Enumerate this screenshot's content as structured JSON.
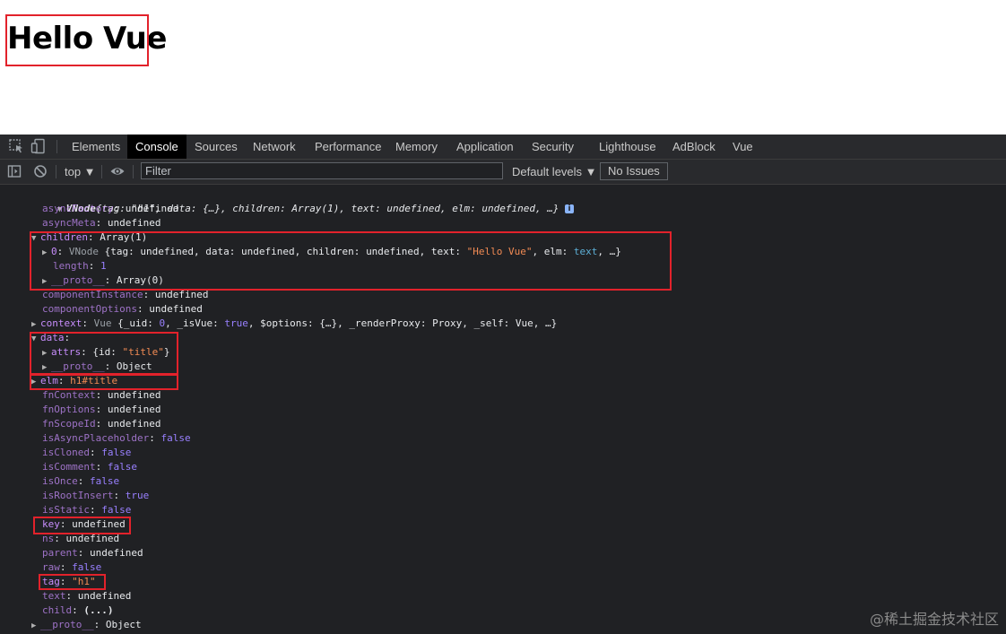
{
  "page": {
    "heading": "Hello Vue"
  },
  "devtools": {
    "tabs": [
      "Elements",
      "Console",
      "Sources",
      "Network",
      "Performance",
      "Memory",
      "Application",
      "Security",
      "Lighthouse",
      "AdBlock",
      "Vue"
    ],
    "active_tab": "Console",
    "toolbar": {
      "context": "top ▼",
      "filter_placeholder": "Filter",
      "levels": "Default levels ▼",
      "issues": "No Issues"
    }
  },
  "console": {
    "header": {
      "name": "VNode",
      "preview": "{tag: \"h1\", data: {…}, children: Array(1), text: undefined, elm: undefined, …}"
    },
    "props": {
      "asyncFactory": {
        "k": "asyncFactory",
        "v": "undefined"
      },
      "asyncMeta": {
        "k": "asyncMeta",
        "v": "undefined"
      },
      "children": {
        "k": "children",
        "v": "Array(1)"
      },
      "children_0": {
        "k": "0",
        "type": "VNode",
        "open": "{tag: ",
        "tag_v": "undefined",
        "sep1": ", data: ",
        "data_v": "undefined",
        "sep2": ", children: ",
        "children_v": "undefined",
        "sep3": ", text: ",
        "text_v": "\"Hello Vue\"",
        "sep4": ", elm: ",
        "elm_v": "text",
        "close": ", …}"
      },
      "length": {
        "k": "length",
        "v": "1"
      },
      "children_proto": {
        "k": "__proto__",
        "v": "Array(0)"
      },
      "componentInstance": {
        "k": "componentInstance",
        "v": "undefined"
      },
      "componentOptions": {
        "k": "componentOptions",
        "v": "undefined"
      },
      "context": {
        "k": "context",
        "type": "Vue",
        "p1": " {_uid: ",
        "uid": "0",
        "p2": ", _isVue: ",
        "isvue": "true",
        "p3": ", $options: {…}, _renderProxy: ",
        "proxy": "Proxy",
        "p4": ", _self: ",
        "self": "Vue",
        "p5": ", …}"
      },
      "data": {
        "k": "data"
      },
      "attrs": {
        "k": "attrs",
        "open": "{id: ",
        "v": "\"title\"",
        "close": "}"
      },
      "data_proto": {
        "k": "__proto__",
        "v": "Object"
      },
      "elm": {
        "k": "elm",
        "v": "h1#title"
      },
      "fnContext": {
        "k": "fnContext",
        "v": "undefined"
      },
      "fnOptions": {
        "k": "fnOptions",
        "v": "undefined"
      },
      "fnScopeId": {
        "k": "fnScopeId",
        "v": "undefined"
      },
      "isAsyncPlaceholder": {
        "k": "isAsyncPlaceholder",
        "v": "false"
      },
      "isCloned": {
        "k": "isCloned",
        "v": "false"
      },
      "isComment": {
        "k": "isComment",
        "v": "false"
      },
      "isOnce": {
        "k": "isOnce",
        "v": "false"
      },
      "isRootInsert": {
        "k": "isRootInsert",
        "v": "true"
      },
      "isStatic": {
        "k": "isStatic",
        "v": "false"
      },
      "key": {
        "k": "key",
        "v": "undefined"
      },
      "ns": {
        "k": "ns",
        "v": "undefined"
      },
      "parent": {
        "k": "parent",
        "v": "undefined"
      },
      "raw": {
        "k": "raw",
        "v": "false"
      },
      "tag": {
        "k": "tag",
        "v": "\"h1\""
      },
      "text": {
        "k": "text",
        "v": "undefined"
      },
      "child": {
        "k": "child",
        "v": "(...)"
      },
      "root_proto": {
        "k": "__proto__",
        "v": "Object"
      }
    }
  },
  "watermark": "@稀土掘金技术社区",
  "colors": {
    "highlight": "#e2222b",
    "devtools_bg": "#202124",
    "key": "#c78dfc",
    "string": "#f28b54",
    "number": "#9980ff"
  }
}
